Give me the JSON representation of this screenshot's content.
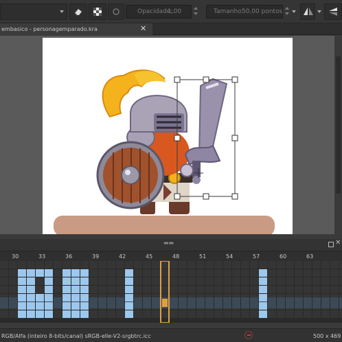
{
  "toolbar": {
    "opacity_label": "Opacidade:",
    "opacity_value": "1,00",
    "size_label": "Tamanho:",
    "size_value": "50,00 pontos"
  },
  "document": {
    "tab_title": "embasico - personagemparado.kra"
  },
  "timeline": {
    "frame_numbers": [
      "30",
      "33",
      "36",
      "39",
      "42",
      "45",
      "48",
      "51",
      "54",
      "57",
      "60",
      "63"
    ],
    "current_frame": "48"
  },
  "statusbar": {
    "color_info": "RGB/Alfa (inteiro 8-bits/canal)  sRGB-elle-V2-srgbtrc.icc",
    "image_size": "500 x 469 ("
  },
  "colors": {
    "keyframe": "#9cc8ee",
    "keyframe_dark": "#4f7fa8",
    "current_frame": "#e0a040",
    "selection_row": "#3c4a58"
  },
  "icons": [
    "erase-icon",
    "alpha-lock-icon",
    "reload-icon",
    "mirror-horizontal-icon",
    "mirror-vertical-icon",
    "close-tab-icon",
    "float-panel-icon",
    "close-panel-icon",
    "stop-icon"
  ]
}
